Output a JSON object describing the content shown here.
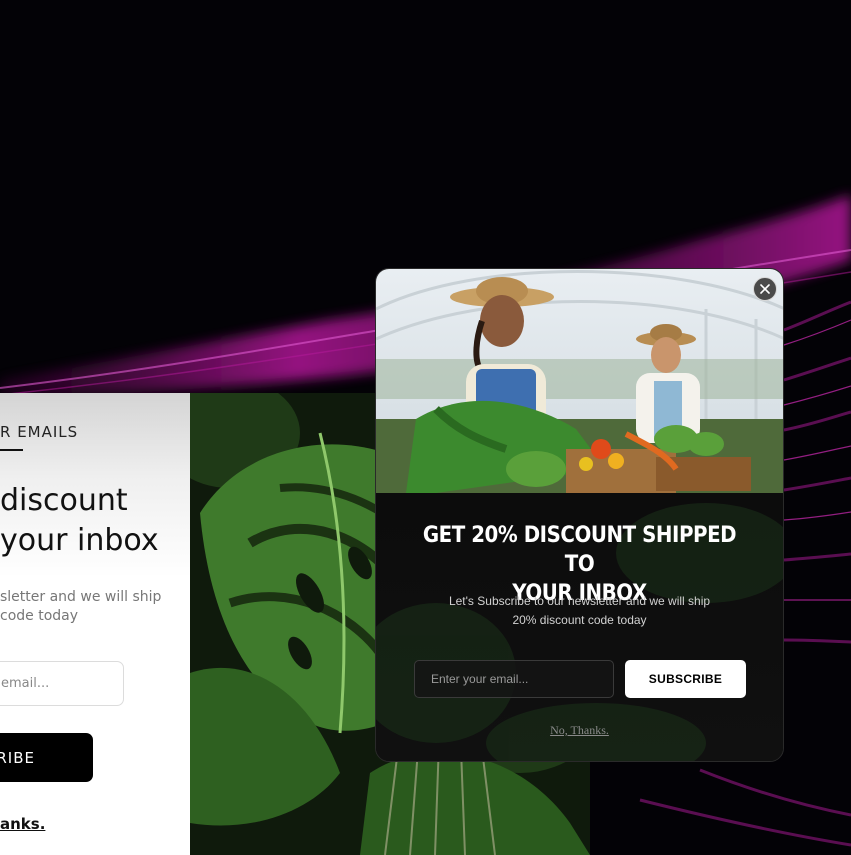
{
  "background": {
    "base_color": "#030206",
    "accent_color": "#a1188f"
  },
  "left_popup": {
    "eyebrow": "R EMAILS",
    "heading_line1": "discount",
    "heading_line2": "your inbox",
    "desc_line1": "sletter and we will ship",
    "desc_line2": "code today",
    "email_placeholder": "email...",
    "subscribe_label": "RIBE",
    "no_thanks_label": "anks."
  },
  "popup": {
    "title_line1": "GET 20% DISCOUNT SHIPPED TO",
    "title_line2": "YOUR INBOX",
    "desc_line1": "Let's Subscribe to our newsletter and we will ship",
    "desc_line2": "20% discount code today",
    "email_placeholder": "Enter your email...",
    "subscribe_label": "SUBSCRIBE",
    "no_thanks_label": "No, Thanks.",
    "close_icon": "close-icon",
    "image_icon": "farmers-photo"
  }
}
